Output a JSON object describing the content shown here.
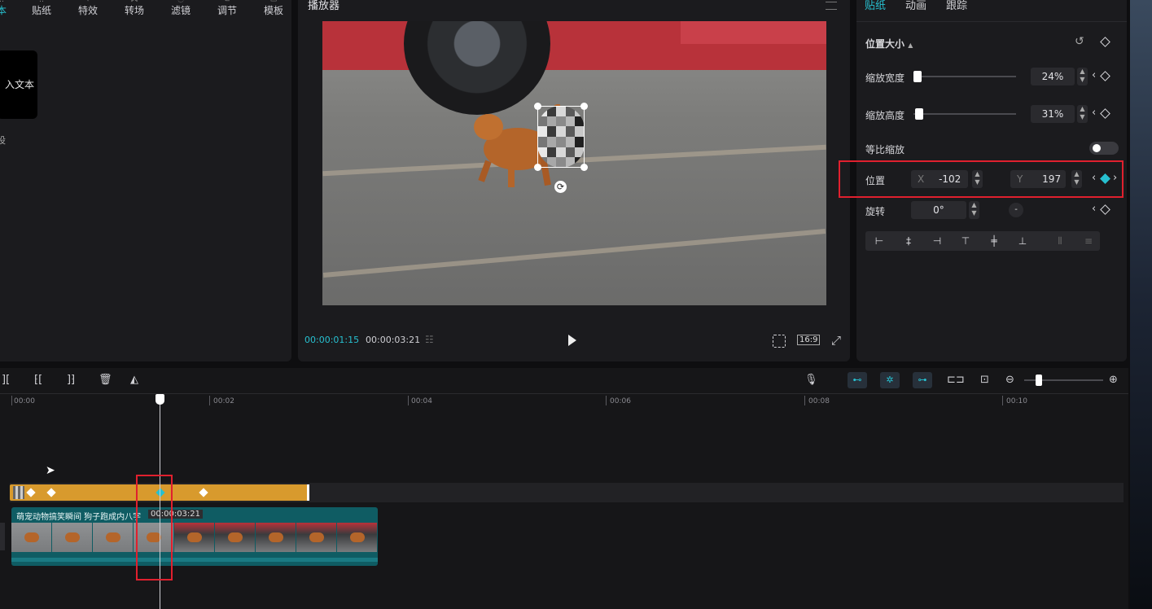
{
  "left_toolbar": {
    "items": [
      {
        "label": "文本",
        "partial": "本"
      },
      {
        "label": "贴纸"
      },
      {
        "label": "特效"
      },
      {
        "label": "转场"
      },
      {
        "label": "滤镜"
      },
      {
        "label": "调节"
      },
      {
        "label": "模板"
      }
    ]
  },
  "left_content": {
    "card_text": "入文本",
    "partial_text": "设"
  },
  "player": {
    "title": "播放器",
    "current_time": "00:00:01:15",
    "total_time": "00:00:03:21",
    "ratio": "16:9"
  },
  "inspector": {
    "tabs": [
      {
        "label": "贴纸",
        "active": true
      },
      {
        "label": "动画",
        "active": false
      },
      {
        "label": "跟踪",
        "active": false
      }
    ],
    "section_title": "位置大小",
    "scale_width": {
      "label": "缩放宽度",
      "value": "24%",
      "level": 0.05
    },
    "scale_height": {
      "label": "缩放高度",
      "value": "31%",
      "level": 0.07
    },
    "uniform_scale": {
      "label": "等比缩放",
      "on": false
    },
    "position": {
      "label": "位置",
      "x_label": "X",
      "x_value": "-102",
      "y_label": "Y",
      "y_value": "197"
    },
    "rotation": {
      "label": "旋转",
      "value": "0°"
    }
  },
  "timeline": {
    "ruler": [
      "00:00",
      "00:02",
      "00:04",
      "00:06",
      "00:08",
      "00:10"
    ],
    "clip_label": "萌宠动物搞笑瞬间 狗子跑成内八字",
    "tooltip": "00:00:03:21"
  },
  "colors": {
    "accent": "#27c0d0",
    "sticker_track": "#d89a2d",
    "video_track": "#0f5c63",
    "highlight": "#e0202e"
  }
}
